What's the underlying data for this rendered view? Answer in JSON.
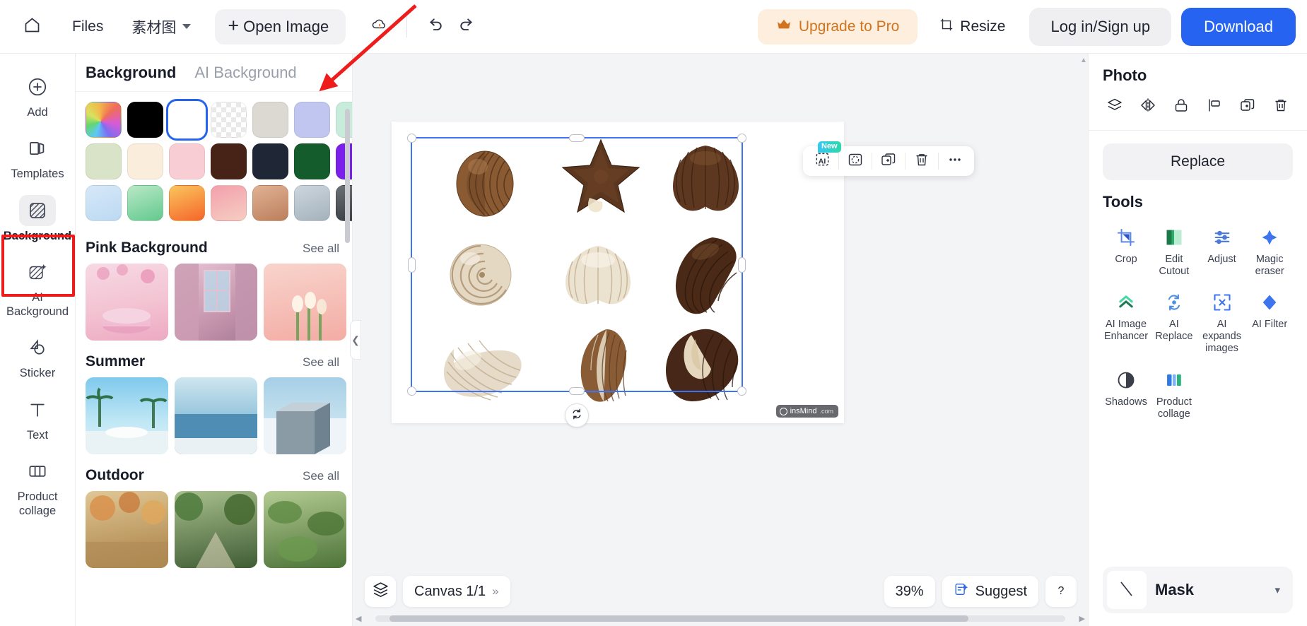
{
  "topbar": {
    "home_icon": "home-icon",
    "files_label": "Files",
    "project_name": "素材图",
    "open_image_label": "Open Image",
    "cloud_icon": "cloud-status-icon",
    "undo_icon": "undo-icon",
    "redo_icon": "redo-icon",
    "upgrade_label": "Upgrade to Pro",
    "upgrade_icon": "crown-icon",
    "upgrade_color": "#d2741d",
    "upgrade_bg": "#fdeedd",
    "resize_label": "Resize",
    "resize_icon": "resize-icon",
    "login_label": "Log in/Sign up",
    "download_label": "Download",
    "download_color": "#2563f0"
  },
  "rail": {
    "items": [
      {
        "label": "Add",
        "icon": "plus-circle-icon"
      },
      {
        "label": "Templates",
        "icon": "templates-icon"
      },
      {
        "label": "Background",
        "icon": "background-hatch-icon"
      },
      {
        "label": "AI Background",
        "icon": "ai-background-icon"
      },
      {
        "label": "Sticker",
        "icon": "sticker-icon"
      },
      {
        "label": "Text",
        "icon": "text-t-icon"
      },
      {
        "label": "Product collage",
        "icon": "product-collage-icon"
      }
    ],
    "active": "Background"
  },
  "panel": {
    "tabs": [
      {
        "label": "Background",
        "active": true
      },
      {
        "label": "AI Background",
        "active": false
      }
    ],
    "swatches": [
      {
        "name": "color-picker",
        "type": "rainbow",
        "hex": ""
      },
      {
        "name": "black",
        "type": "solid",
        "hex": "#000000"
      },
      {
        "name": "white",
        "type": "solid",
        "hex": "#ffffff",
        "selected": true
      },
      {
        "name": "transparent",
        "type": "checker",
        "hex": ""
      },
      {
        "name": "warm-grey",
        "type": "solid",
        "hex": "#dcd9d2"
      },
      {
        "name": "periwinkle",
        "type": "solid",
        "hex": "#c0c6ef"
      },
      {
        "name": "mint",
        "type": "solid",
        "hex": "#c7ecdc"
      },
      {
        "name": "sage",
        "type": "solid",
        "hex": "#d9e3c8"
      },
      {
        "name": "cream",
        "type": "solid",
        "hex": "#fbeddc"
      },
      {
        "name": "pink",
        "type": "solid",
        "hex": "#f9cdd4"
      },
      {
        "name": "dark-brown",
        "type": "solid",
        "hex": "#472217"
      },
      {
        "name": "navy",
        "type": "solid",
        "hex": "#1f2736"
      },
      {
        "name": "forest-green",
        "type": "solid",
        "hex": "#155c2c"
      },
      {
        "name": "violet",
        "type": "solid",
        "hex": "#7a20e8"
      },
      {
        "name": "blue-gradient",
        "type": "gradient",
        "hex": "#bcd9f2",
        "hex2": "#d6e8f8"
      },
      {
        "name": "green-gradient",
        "type": "gradient",
        "hex": "#86d9a6",
        "hex2": "#b9e8c6"
      },
      {
        "name": "orange-gradient",
        "type": "gradient",
        "hex": "#f97b2e",
        "hex2": "#fbc55e"
      },
      {
        "name": "rose-gradient",
        "type": "gradient",
        "hex": "#f3a0ad",
        "hex2": "#f6cdc1"
      },
      {
        "name": "tan-gradient",
        "type": "gradient",
        "hex": "#c98a6b",
        "hex2": "#e0b294"
      },
      {
        "name": "steel-gradient",
        "type": "gradient",
        "hex": "#b0bcc6",
        "hex2": "#cdd6dd"
      },
      {
        "name": "charcoal-gradient",
        "type": "gradient",
        "hex": "#3b4146",
        "hex2": "#6b7175"
      }
    ],
    "sections": [
      {
        "title": "Pink Background",
        "see_all": "See all",
        "thumbs": [
          {
            "name": "pink-podium-blossom",
            "c1": "#f3c3d2",
            "c2": "#eda9c2",
            "c3": "#f7d9e4"
          },
          {
            "name": "pink-window-curtain",
            "c1": "#d9a0bb",
            "c2": "#b9839f",
            "c3": "#e9c6d6"
          },
          {
            "name": "pink-tulips",
            "c1": "#f5b9b2",
            "c2": "#e89d98",
            "c3": "#f8d4cc"
          }
        ]
      },
      {
        "title": "Summer",
        "see_all": "See all",
        "thumbs": [
          {
            "name": "palm-trees-podium",
            "c1": "#6fc3e8",
            "c2": "#3f9fd4",
            "c3": "#bde6f5"
          },
          {
            "name": "ocean-horizon",
            "c1": "#7cb8d9",
            "c2": "#4f8db5",
            "c3": "#cfe6f0"
          },
          {
            "name": "white-block-sky",
            "c1": "#a6cfe6",
            "c2": "#7ab0cf",
            "c3": "#e2edf2"
          }
        ]
      },
      {
        "title": "Outdoor",
        "see_all": "See all",
        "thumbs": [
          {
            "name": "autumn-foliage",
            "c1": "#c9a66b",
            "c2": "#8e6b3a",
            "c3": "#e0c795"
          },
          {
            "name": "forest-path",
            "c1": "#6f8f5a",
            "c2": "#3f5c34",
            "c3": "#a9c08d"
          },
          {
            "name": "green-leaves",
            "c1": "#7fa45f",
            "c2": "#4d7339",
            "c3": "#b3cb92"
          }
        ]
      }
    ],
    "collapse_icon": "chevron-left-icon"
  },
  "canvas": {
    "float_toolbar": [
      {
        "name": "ai-cutout",
        "icon": "ai-frame-icon",
        "badge": "New"
      },
      {
        "name": "select-subject",
        "icon": "dashed-circle-icon",
        "badge": ""
      },
      {
        "name": "duplicate",
        "icon": "duplicate-icon",
        "badge": ""
      },
      {
        "name": "delete",
        "icon": "trash-icon",
        "badge": ""
      },
      {
        "name": "more",
        "icon": "ellipsis-icon",
        "badge": ""
      }
    ],
    "watermark": "insMind",
    "watermark_suffix": ".com",
    "rotate_icon": "rotate-icon",
    "selection_color": "#3d74f0",
    "objects": [
      {
        "name": "chocolate-conch-shell",
        "row": 0,
        "col": 0,
        "tone": "#7b4a2a"
      },
      {
        "name": "chocolate-starfish",
        "row": 0,
        "col": 1,
        "tone": "#5c3720"
      },
      {
        "name": "chocolate-scallop",
        "row": 0,
        "col": 2,
        "tone": "#6d4125"
      },
      {
        "name": "white-spiral-shell",
        "row": 1,
        "col": 0,
        "tone": "#d9cbb8"
      },
      {
        "name": "white-fan-shell",
        "row": 1,
        "col": 1,
        "tone": "#e2d7c6"
      },
      {
        "name": "dark-ridged-shell",
        "row": 1,
        "col": 2,
        "tone": "#4f2f1b"
      },
      {
        "name": "white-scallop",
        "row": 2,
        "col": 0,
        "tone": "#ded3c1"
      },
      {
        "name": "two-tone-shell",
        "row": 2,
        "col": 1,
        "tone": "#8a5c35"
      },
      {
        "name": "marbled-chocolate-shell",
        "row": 2,
        "col": 2,
        "tone": "#48291a"
      }
    ]
  },
  "bottombar": {
    "layers_icon": "layers-icon",
    "canvas_label": "Canvas 1/1",
    "canvas_expand_icon": "double-chevron-right-icon",
    "zoom_level": "39%",
    "suggest_label": "Suggest",
    "suggest_icon": "suggest-icon",
    "help_label": "?"
  },
  "rightpanel": {
    "title": "Photo",
    "icons": [
      {
        "name": "layers-icon"
      },
      {
        "name": "flip-icon"
      },
      {
        "name": "lock-icon"
      },
      {
        "name": "align-icon"
      },
      {
        "name": "duplicate-icon"
      },
      {
        "name": "trash-icon"
      }
    ],
    "replace_label": "Replace",
    "tools_title": "Tools",
    "tools": [
      {
        "label": "Crop",
        "icon": "crop-icon",
        "color": "#5b86e8"
      },
      {
        "label": "Edit Cutout",
        "icon": "edit-cutout-icon",
        "color": "#2faa6a"
      },
      {
        "label": "Adjust",
        "icon": "adjust-icon",
        "color": "#4a7ae0"
      },
      {
        "label": "Magic eraser",
        "icon": "magic-eraser-icon",
        "color": "#3d74f0"
      },
      {
        "label": "AI Image Enhancer",
        "icon": "ai-enhancer-icon",
        "color": "#2fbf8f"
      },
      {
        "label": "AI Replace",
        "icon": "ai-replace-icon",
        "color": "#4a8ee0"
      },
      {
        "label": "AI expands images",
        "icon": "ai-expand-icon",
        "color": "#3d74f0"
      },
      {
        "label": "AI Filter",
        "icon": "ai-filter-icon",
        "color": "#3d74f0"
      },
      {
        "label": "Shadows",
        "icon": "shadows-icon",
        "color": "#3a3f4a"
      },
      {
        "label": "Product collage",
        "icon": "product-collage-icon",
        "color": "#2f7ae0"
      }
    ],
    "mask_label": "Mask",
    "mask_icon": "mask-stroke-icon",
    "mask_chevron": "chevron-down-icon"
  },
  "annotation": {
    "arrow_color": "#ef1c1c",
    "highlight_color": "#ef1c1c",
    "highlight_target": "Background"
  }
}
